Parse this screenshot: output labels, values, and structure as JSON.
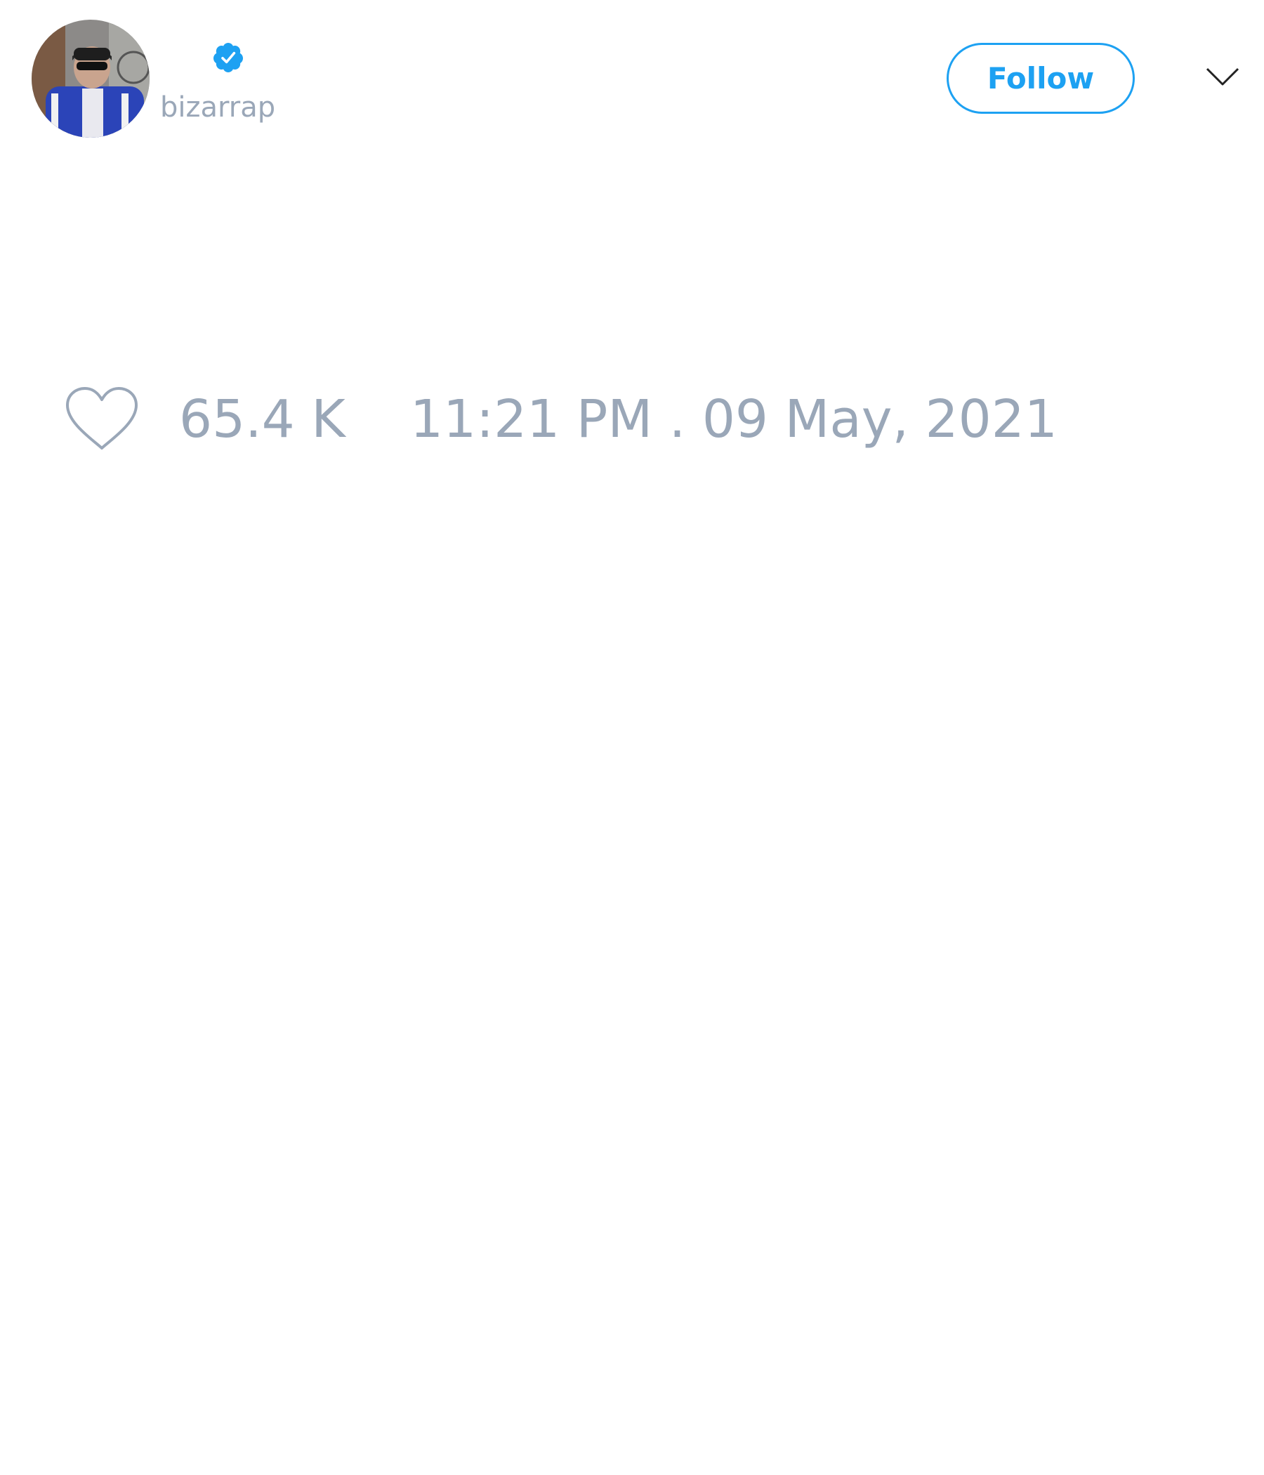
{
  "tweet": {
    "author": {
      "handle": "bizarrap",
      "verified": true,
      "avatar_icon": "user-avatar-photo"
    },
    "follow_label": "Follow",
    "menu_icon": "chevron-down-icon",
    "likes": {
      "icon": "heart-outline-icon",
      "count": "65.4 K"
    },
    "timestamp": "11:21 PM . 09 May, 2021"
  },
  "colors": {
    "accent": "#1da1f2",
    "muted_text": "#9aa7b8",
    "background": "#ffffff"
  }
}
